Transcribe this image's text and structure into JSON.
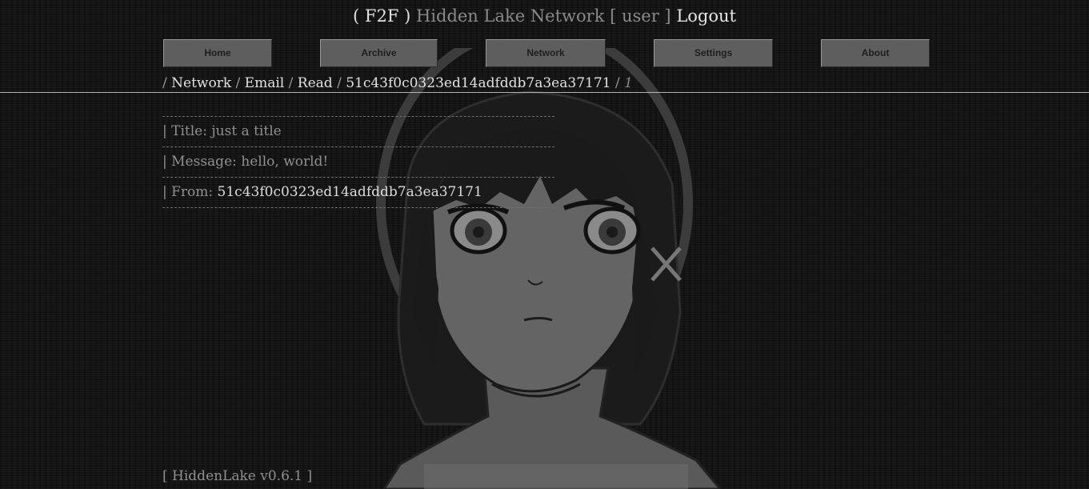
{
  "header": {
    "mode": "( F2F )",
    "network_name": "Hidden Lake Network",
    "user_label": "[ user ]",
    "logout_label": "Logout"
  },
  "nav": {
    "home": "Home",
    "archive": "Archive",
    "network": "Network",
    "settings": "Settings",
    "about": "About"
  },
  "breadcrumb": {
    "sep": "/",
    "items": [
      "Network",
      "Email",
      "Read",
      "51c43f0c0323ed14adfddb7a3ea37171"
    ],
    "current": "1"
  },
  "message": {
    "title_label": "| Title:",
    "title_value": "just a title",
    "message_label": "| Message:",
    "message_value": "hello, world!",
    "from_label": "| From:",
    "from_value": "51c43f0c0323ed14adfddb7a3ea37171"
  },
  "footer": {
    "version": "[ HiddenLake v0.6.1 ]"
  }
}
